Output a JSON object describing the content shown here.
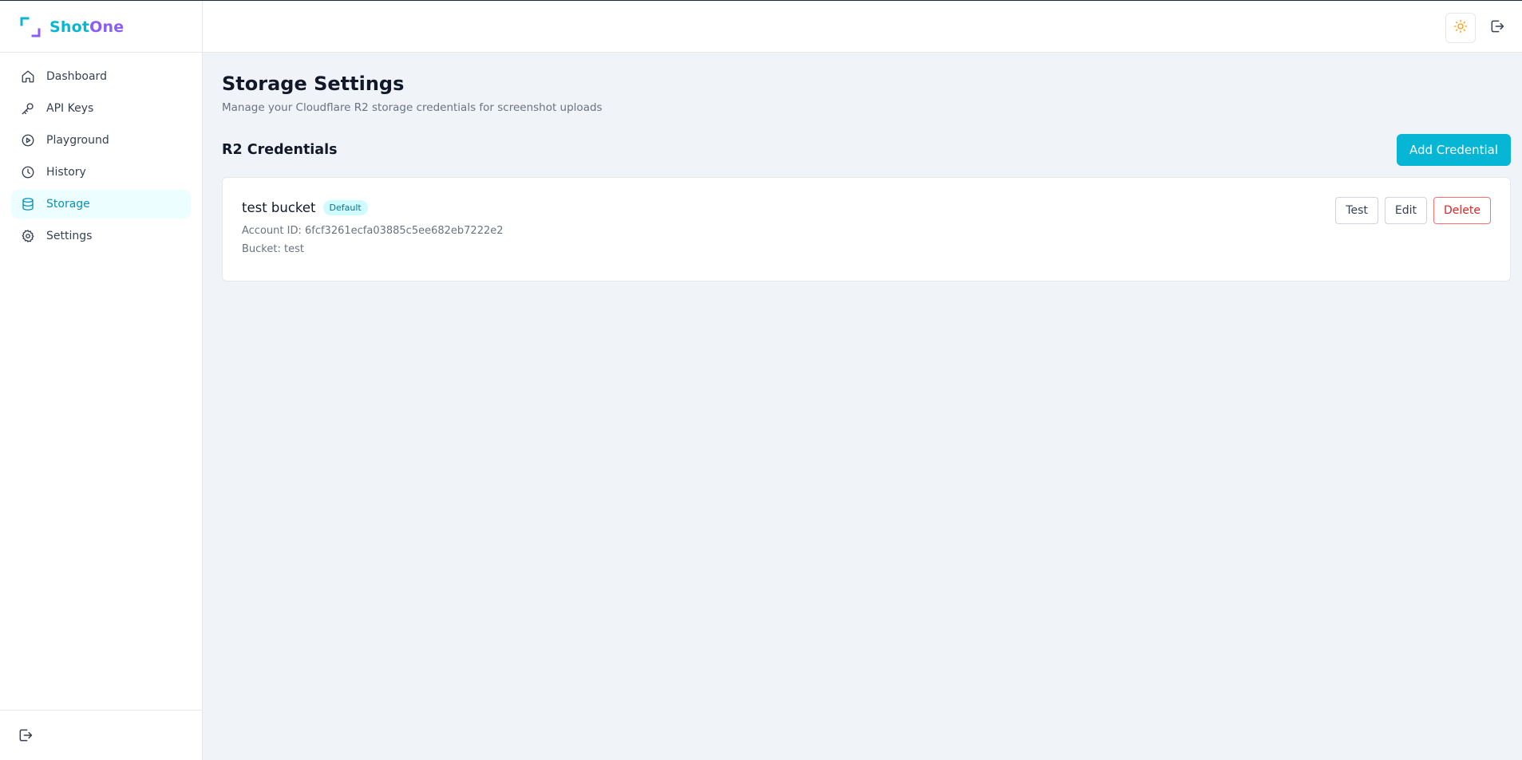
{
  "brand": {
    "name_part1": "Shot",
    "name_part2": "One"
  },
  "sidebar": {
    "items": [
      {
        "label": "Dashboard",
        "icon": "home-icon",
        "active": false
      },
      {
        "label": "API Keys",
        "icon": "key-icon",
        "active": false
      },
      {
        "label": "Playground",
        "icon": "play-circle-icon",
        "active": false
      },
      {
        "label": "History",
        "icon": "clock-icon",
        "active": false
      },
      {
        "label": "Storage",
        "icon": "database-icon",
        "active": true
      },
      {
        "label": "Settings",
        "icon": "gear-icon",
        "active": false
      }
    ],
    "footer_icon": "logout-icon"
  },
  "topbar": {
    "theme_icon": "sun-icon",
    "logout_icon": "logout-icon"
  },
  "page": {
    "title": "Storage Settings",
    "subtitle": "Manage your Cloudflare R2 storage credentials for screenshot uploads"
  },
  "section": {
    "title": "R2 Credentials",
    "add_button_label": "Add Credential"
  },
  "credentials": [
    {
      "name": "test bucket",
      "badge": "Default",
      "account_line": "Account ID: 6fcf3261ecfa03885c5ee682eb7222e2",
      "bucket_line": "Bucket: test",
      "actions": {
        "test": "Test",
        "edit": "Edit",
        "delete": "Delete"
      }
    }
  ],
  "colors": {
    "accent": "#06b6d4",
    "brand_secondary": "#8b5cf6",
    "danger": "#dc2626",
    "background": "#f0f3f8",
    "active_nav_bg": "#ecfeff"
  }
}
